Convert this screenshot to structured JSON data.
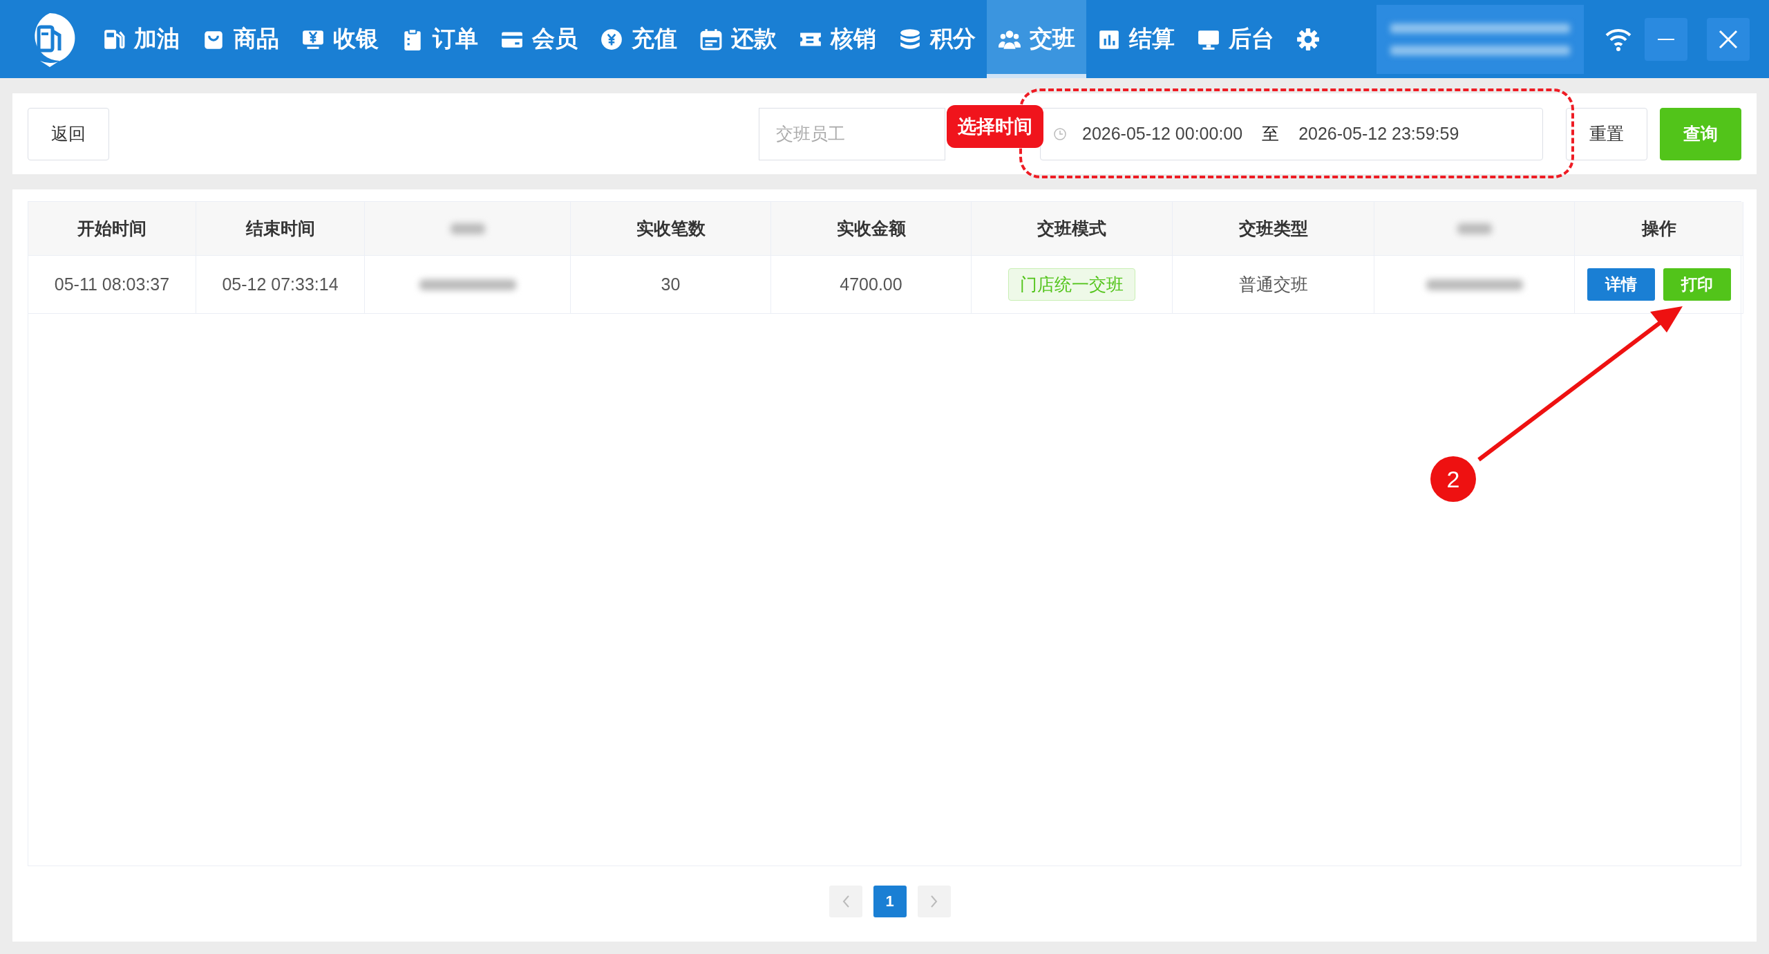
{
  "nav": {
    "items": [
      {
        "label": "加油",
        "selected": false
      },
      {
        "label": "商品",
        "selected": false
      },
      {
        "label": "收银",
        "selected": false
      },
      {
        "label": "订单",
        "selected": false
      },
      {
        "label": "会员",
        "selected": false
      },
      {
        "label": "充值",
        "selected": false
      },
      {
        "label": "还款",
        "selected": false
      },
      {
        "label": "核销",
        "selected": false
      },
      {
        "label": "积分",
        "selected": false
      },
      {
        "label": "交班",
        "selected": true
      },
      {
        "label": "结算",
        "selected": false
      },
      {
        "label": "后台",
        "selected": false
      },
      {
        "selected": false
      }
    ]
  },
  "toolbar": {
    "back_button": "返回",
    "employee_field": {
      "placeholder": "交班员工"
    },
    "date_range": {
      "start": "2026-05-12 00:00:00",
      "separator": "至",
      "end": "2026-05-12 23:59:59"
    },
    "reset_button": "重置",
    "query_button": "查询"
  },
  "table": {
    "columns": [
      {
        "kind": "text",
        "label": "开始时间"
      },
      {
        "kind": "text",
        "label": "结束时间"
      },
      {
        "kind": "blurred"
      },
      {
        "kind": "text",
        "label": "实收笔数"
      },
      {
        "kind": "text",
        "label": "实收金额"
      },
      {
        "kind": "text",
        "label": "交班模式"
      },
      {
        "kind": "text",
        "label": "交班类型"
      },
      {
        "kind": "blurred"
      },
      {
        "kind": "text",
        "label": "操作"
      }
    ],
    "rows": [
      {
        "cells": [
          {
            "kind": "text",
            "text": "05-11 08:03:37"
          },
          {
            "kind": "text",
            "text": "05-12 07:33:14"
          },
          {
            "kind": "blurred"
          },
          {
            "kind": "text",
            "text": "30"
          },
          {
            "kind": "text",
            "text": "4700.00"
          },
          {
            "kind": "tag",
            "text": "门店统一交班"
          },
          {
            "kind": "text",
            "text": "普通交班"
          },
          {
            "kind": "blurred"
          },
          {
            "kind": "actions",
            "buttons": [
              {
                "kind": "detail",
                "label": "详情"
              },
              {
                "kind": "print",
                "label": "打印"
              }
            ]
          }
        ]
      }
    ]
  },
  "pagination": {
    "pages": [
      {
        "label": "1",
        "selected": true
      }
    ]
  },
  "annotations": {
    "callout": "选择时间",
    "step": "2"
  }
}
